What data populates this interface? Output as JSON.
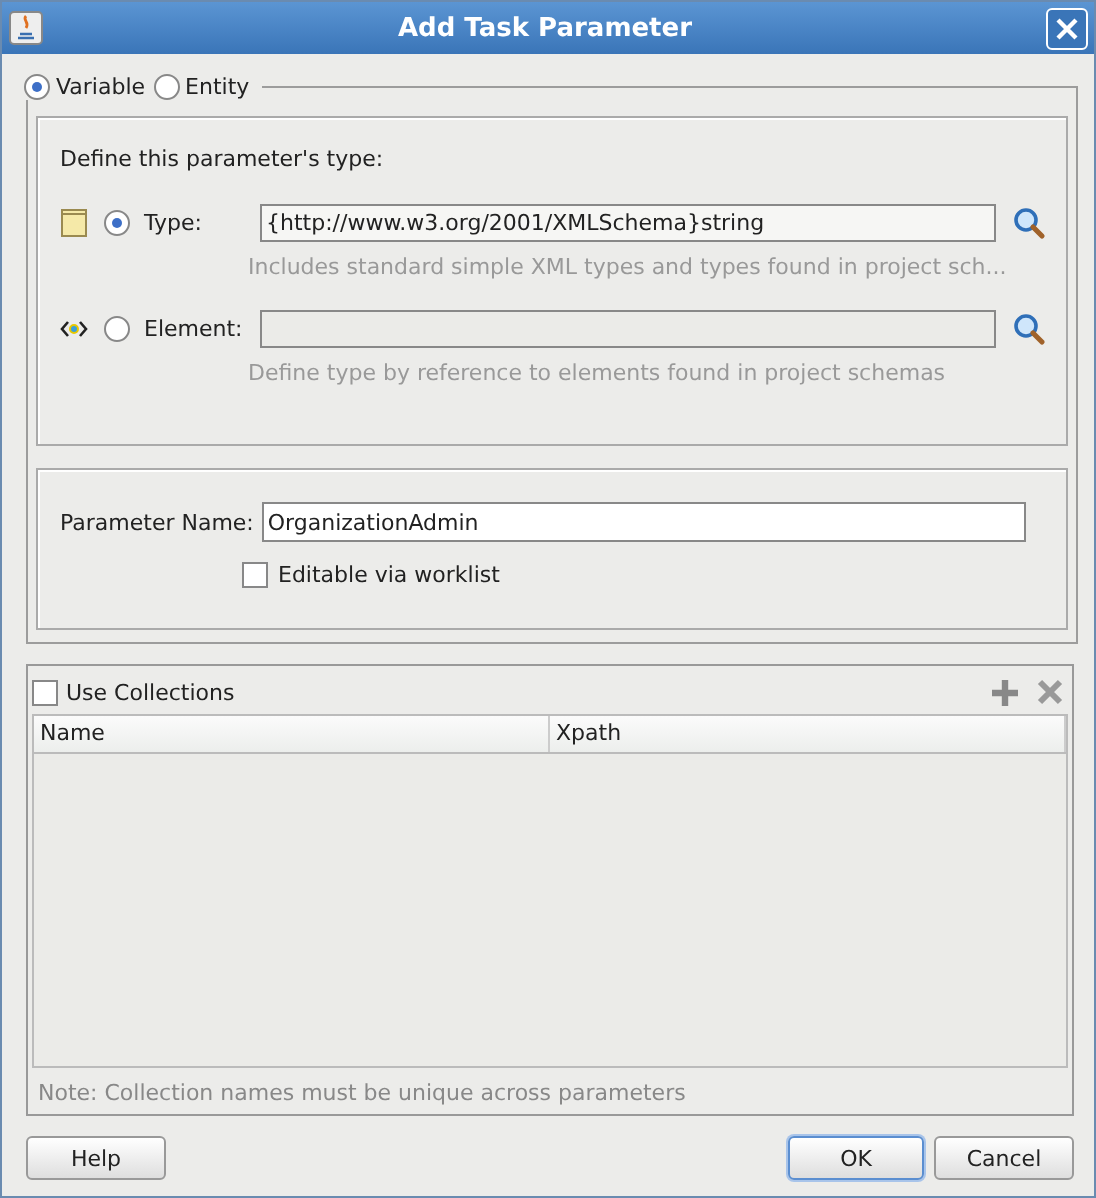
{
  "window": {
    "title": "Add Task Parameter"
  },
  "parameter_kind": [
    {
      "label": "Variable",
      "selected": true
    },
    {
      "label": "Entity",
      "selected": false
    }
  ],
  "type_section": {
    "heading": "Define this parameter's type:",
    "options": [
      {
        "kind": "type",
        "label": "Type:",
        "selected": true,
        "value": "{http://www.w3.org/2001/XMLSchema}string",
        "hint": "Includes standard simple XML types and types found in project sch..."
      },
      {
        "kind": "element",
        "label": "Element:",
        "selected": false,
        "hint": "Define type by reference to elements found in project schemas"
      }
    ]
  },
  "parameter_name": {
    "label": "Parameter Name:",
    "value": "OrganizationAdmin"
  },
  "editable": {
    "label": "Editable via worklist",
    "checked": false
  },
  "collections": {
    "label": "Use Collections",
    "checked": false,
    "columns": [
      "Name",
      "Xpath"
    ],
    "note": "Note: Collection names must be unique across parameters"
  },
  "buttons": [
    {
      "label": "Help",
      "default": false
    },
    {
      "label": "OK",
      "default": true
    },
    {
      "label": "Cancel",
      "default": false
    }
  ]
}
